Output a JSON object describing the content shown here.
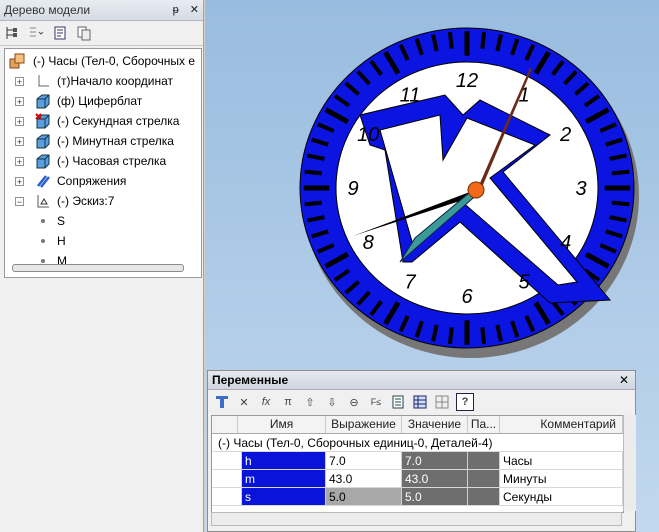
{
  "tree_panel": {
    "title": "Дерево модели",
    "pin_glyph": "ᵽ",
    "close_glyph": "✕",
    "toolbar_icons": [
      "hierarchy-icon",
      "view-options-icon",
      "properties-icon",
      "copy-icon"
    ],
    "items": [
      {
        "label": "(-) Часы (Тел-0, Сборочных е",
        "icon": "assembly-icon"
      },
      {
        "label": "(т)Начало координат",
        "icon": "origin-icon"
      },
      {
        "label": "(ф) Циферблат",
        "icon": "part-icon"
      },
      {
        "label": "(-) Секундная стрелка",
        "icon": "part-icon"
      },
      {
        "label": "(-) Минутная стрелка",
        "icon": "part-icon"
      },
      {
        "label": "(-) Часовая стрелка",
        "icon": "part-icon"
      },
      {
        "label": "Сопряжения",
        "icon": "mates-icon"
      },
      {
        "label": "(-) Эскиз:7",
        "icon": "sketch-icon"
      },
      {
        "label": "S",
        "icon": "dot-icon"
      },
      {
        "label": "H",
        "icon": "dot-icon"
      },
      {
        "label": "M",
        "icon": "dot-icon"
      }
    ]
  },
  "viewport": {
    "clock_numbers": [
      "12",
      "1",
      "2",
      "3",
      "4",
      "5",
      "6",
      "7",
      "8",
      "9",
      "10",
      "11"
    ],
    "colors": {
      "rim": "#0b14e0",
      "face": "#ffffff",
      "hand_second": "#6b2a18",
      "hand_minute": "#3a9a98",
      "hand_hour": "#000000",
      "hub": "#f06a1a"
    }
  },
  "variables": {
    "title": "Переменные",
    "close_glyph": "✕",
    "toolbar_icons": [
      "insert-icon",
      "delete-icon",
      "function-icon",
      "pi-icon",
      "up-icon",
      "down-icon",
      "link-icon",
      "edit-icon",
      "list-icon",
      "table-icon",
      "grid-icon",
      "help-icon"
    ],
    "columns": [
      "Имя",
      "Выражение",
      "Значение",
      "Па...",
      "Комментарий"
    ],
    "group_row": "(-) Часы (Тел-0, Сборочных единиц-0, Деталей-4)",
    "rows": [
      {
        "name": "h",
        "expr": "7.0",
        "value": "7.0",
        "param": "",
        "comment": "Часы"
      },
      {
        "name": "m",
        "expr": "43.0",
        "value": "43.0",
        "param": "",
        "comment": "Минуты"
      },
      {
        "name": "s",
        "expr": "5.0",
        "value": "5.0",
        "param": "",
        "comment": "Секунды"
      }
    ]
  }
}
